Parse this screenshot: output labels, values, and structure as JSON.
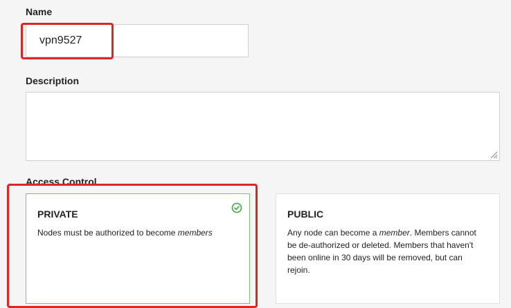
{
  "form": {
    "name_label": "Name",
    "name_value": "vpn9527",
    "description_label": "Description",
    "description_value": "",
    "access_label": "Access Control"
  },
  "access_options": [
    {
      "title": "PRIVATE",
      "description_pre": "Nodes must be authorized to become ",
      "description_em": "members",
      "selected": true
    },
    {
      "title": "PUBLIC",
      "description_pre": "Any node can become a ",
      "description_em": "member",
      "description_post": ". Members cannot be de-authorized or deleted. Members that haven't been online in 30 days will be removed, but can rejoin.",
      "selected": false
    }
  ],
  "colors": {
    "highlight": "#e02424",
    "selected_border": "#7dc17d",
    "check": "#4caf50"
  },
  "icons": {
    "selected": "check-circle-icon",
    "textarea_resize": "resize-grip-icon"
  }
}
